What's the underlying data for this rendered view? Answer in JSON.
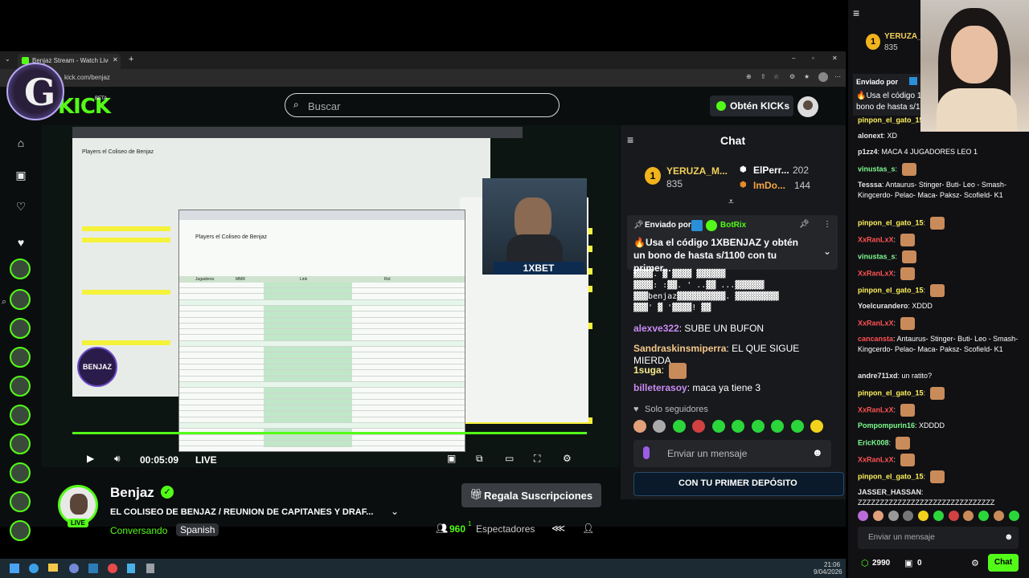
{
  "browser": {
    "tab_title": "Benjaz Stream - Watch Live on Kick",
    "url": "kick.com/benjaz"
  },
  "header": {
    "logo_text": "KICK",
    "logo_beta": "BETA",
    "search_placeholder": "Buscar",
    "kicks_button": "Obtén KICKs"
  },
  "video": {
    "time": "00:05:09",
    "live_label": "LIVE",
    "sheet_title": "Players el Coliseo de Benjaz",
    "sheet_headers": [
      "Jugadores",
      "MMR",
      "Link",
      "Rol"
    ],
    "sponsor_text": "1XBET",
    "overlay_logo": "BENJAZ"
  },
  "stream_info": {
    "streamer_name": "Benjaz",
    "title": "EL COLISEO DE BENJAZ / REUNION DE CAPITANES Y DRAF...",
    "category": "Conversando",
    "language_tag": "Spanish",
    "live_badge": "LIVE",
    "gift_button": "Regala Suscripciones",
    "viewer_count": "960",
    "viewer_sup": "1",
    "viewers_label": "Espectadores"
  },
  "chat": {
    "title": "Chat",
    "leaderboard": [
      {
        "name": "YERUZA_M...",
        "value": "835"
      },
      {
        "name": "ElPerr...",
        "value": "202"
      },
      {
        "name": "ImDo...",
        "value": "144"
      }
    ],
    "pinned_prefix": "Enviado por",
    "pinned_by": "BotRix",
    "pinned_text": "🔥Usa el código 1XBENJAZ y obtén un bono de hasta s/1100 con tu primer...",
    "ascii_art_1": "▓▓▓▓.  ▓  ▓▓▓▓    ▓▓▓▓▓▓",
    "ascii_art_2": "▓▓▓▓:  :▓▓. ' ..▓▓   ...▓▓▓▓▓▓",
    "ascii_art_3": "▓▓▓benjaz▓▓▓▓▓▓▓▓▓▓. ▓▓▓▓▓▓▓▓▓",
    "ascii_art_4": "▓▓▓'   ▓   '▓▓▓▓! ▓▓",
    "messages": [
      {
        "user": "alexve322",
        "text": "SUBE UN BUFON"
      },
      {
        "user": "Sandraskinsmiperra",
        "text": "EL QUE SIGUE MIERDA"
      },
      {
        "user": "1suga",
        "text": ""
      },
      {
        "user": "billeterasoy",
        "text": "maca ya tiene 3"
      }
    ],
    "followers_only": "Solo seguidores",
    "input_placeholder": "Enviar un mensaje",
    "banner_text": "CON TU PRIMER DEPÓSITO"
  },
  "overlay": {
    "top_user": "YERUZA_M",
    "top_value": "835",
    "pinned_prefix": "Enviado por",
    "pinned_text_1": "🔥Usa el código 1",
    "pinned_text_2": "bono de hasta s/1",
    "messages": [
      {
        "user": "pinpon_el_gato_15",
        "text": "",
        "color": "y"
      },
      {
        "user": "alonext",
        "text": "XD",
        "color": "w"
      },
      {
        "user": "p1zz4",
        "text": "MACA 4 JUGADORES LEO 1",
        "color": "w"
      },
      {
        "user": "vinustas_s",
        "text": "",
        "color": "c"
      },
      {
        "user": "Tesssa",
        "text": "Antaurus- Stinger- Buti- Leo - Smash- Kingcerdo- Pelao- Maca- Paksz- Scofield- K1",
        "color": "w"
      },
      {
        "user": "pinpon_el_gato_15",
        "text": "",
        "color": "y"
      },
      {
        "user": "XxRanLxX",
        "text": "",
        "color": "r"
      },
      {
        "user": "vinustas_s",
        "text": "",
        "color": "c"
      },
      {
        "user": "XxRanLxX",
        "text": "",
        "color": "r"
      },
      {
        "user": "pinpon_el_gato_15",
        "text": "",
        "color": "y"
      },
      {
        "user": "Yoelcurandero",
        "text": "XDDD",
        "color": "w"
      },
      {
        "user": "XxRanLxX",
        "text": "",
        "color": "r"
      },
      {
        "user": "cancansta",
        "text": "Antaurus- Stinger- Buti- Leo - Smash- Kingcerdo- Pelao- Maca- Paksz- Scofield- K1",
        "color": "r"
      },
      {
        "user": "andre711xd",
        "text": "un ratito?",
        "color": "w"
      },
      {
        "user": "pinpon_el_gato_15",
        "text": "",
        "color": "y"
      },
      {
        "user": "XxRanLxX",
        "text": "",
        "color": "r"
      },
      {
        "user": "Pompompurin16",
        "text": "XDDDD",
        "color": "c"
      },
      {
        "user": "EricK008",
        "text": "",
        "color": "c"
      },
      {
        "user": "XxRanLxX",
        "text": "",
        "color": "r"
      },
      {
        "user": "pinpon_el_gato_15",
        "text": "",
        "color": "y"
      },
      {
        "user": "JASSER_HASSAN",
        "text": "ZZZZZZZZZZZZZZZZZZZZZZZZZZZZZZZ",
        "color": "w"
      }
    ],
    "input_placeholder": "Enviar un mensaje",
    "points": "2990",
    "gift_count": "0",
    "chat_button": "Chat"
  },
  "taskbar": {
    "time": "21:06",
    "date": "9/04/2026"
  }
}
